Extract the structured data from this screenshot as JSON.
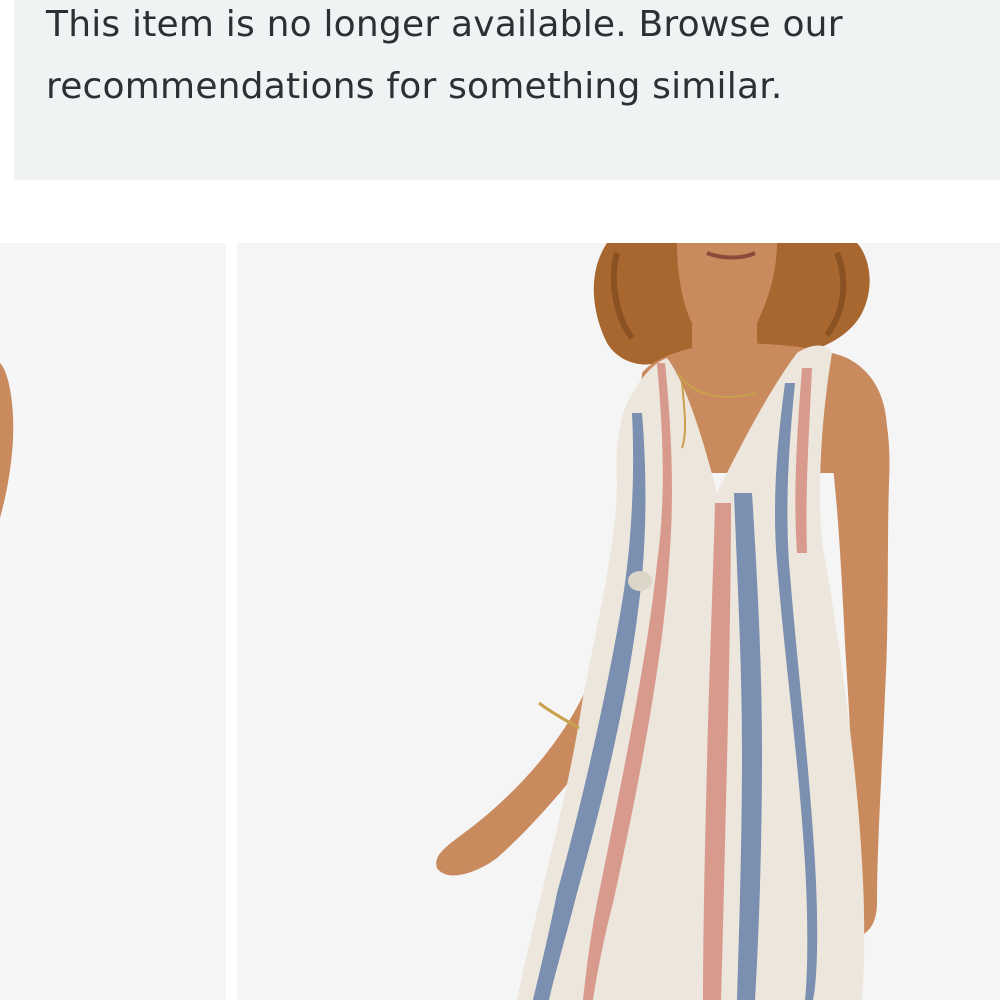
{
  "notice": {
    "message": "This item is no longer available. Browse our recommendations for something similar."
  },
  "gallery": {
    "colors": {
      "thumb_bg": "#f6f6f6",
      "main_bg": "#f5f5f5",
      "skin": "#c98a5e",
      "hair": "#a8672f",
      "dress_base": "#ece6dc",
      "stripe_blue": "#7b8fb0",
      "stripe_pink": "#d99a8e"
    }
  }
}
